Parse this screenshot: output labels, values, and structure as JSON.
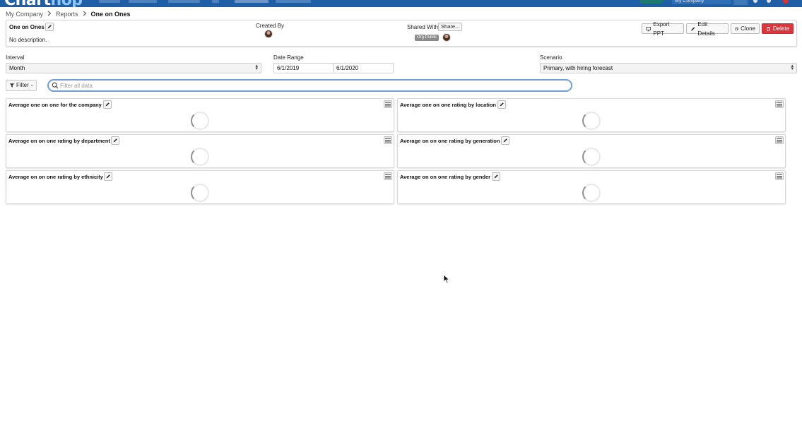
{
  "app": {
    "logo_text": "ChartHop",
    "logo_part1": "Chart",
    "logo_part2": "hop",
    "company_selector": "My Company"
  },
  "breadcrumb": {
    "items": [
      "My Company",
      "Reports",
      "One on Ones"
    ]
  },
  "report": {
    "title": "One on Ones",
    "description": "No description.",
    "created_by_label": "Created By",
    "shared_with_label": "Shared With",
    "share_button": "Share...",
    "org_badge": "Org Public",
    "buttons": {
      "export": "Export PPT",
      "edit": "Edit Details",
      "clone": "Clone",
      "delete": "Delete"
    }
  },
  "filters": {
    "interval_label": "Interval",
    "interval_value": "Month",
    "date_range_label": "Date Range",
    "date_start": "6/1/2019",
    "date_end": "6/1/2020",
    "scenario_label": "Scenario",
    "scenario_value": "Primary, with hiring forecast",
    "filter_button": "Filter",
    "search_placeholder": "Filter all data"
  },
  "widgets": [
    {
      "title": "Average one on one for the company"
    },
    {
      "title": "Average one on one rating by location"
    },
    {
      "title": "Average on on one rating by department"
    },
    {
      "title": "Average on on one rating by generation"
    },
    {
      "title": "Average on on one rating by ethnicity"
    },
    {
      "title": "Average on on one rating by gender"
    }
  ],
  "colors": {
    "nav_bg": "#1f5fa6",
    "delete_bg": "#d9363e",
    "search_border": "#6f9fd6",
    "org_badge_bg": "#8b8b8b"
  },
  "icons": [
    "pencil-icon",
    "hamburger-menu-icon",
    "loading-spinner-icon",
    "filter-funnel-icon",
    "search-icon",
    "monitor-icon",
    "copy-icon",
    "trash-icon",
    "chevron-right-icon",
    "sort-arrows-icon"
  ]
}
